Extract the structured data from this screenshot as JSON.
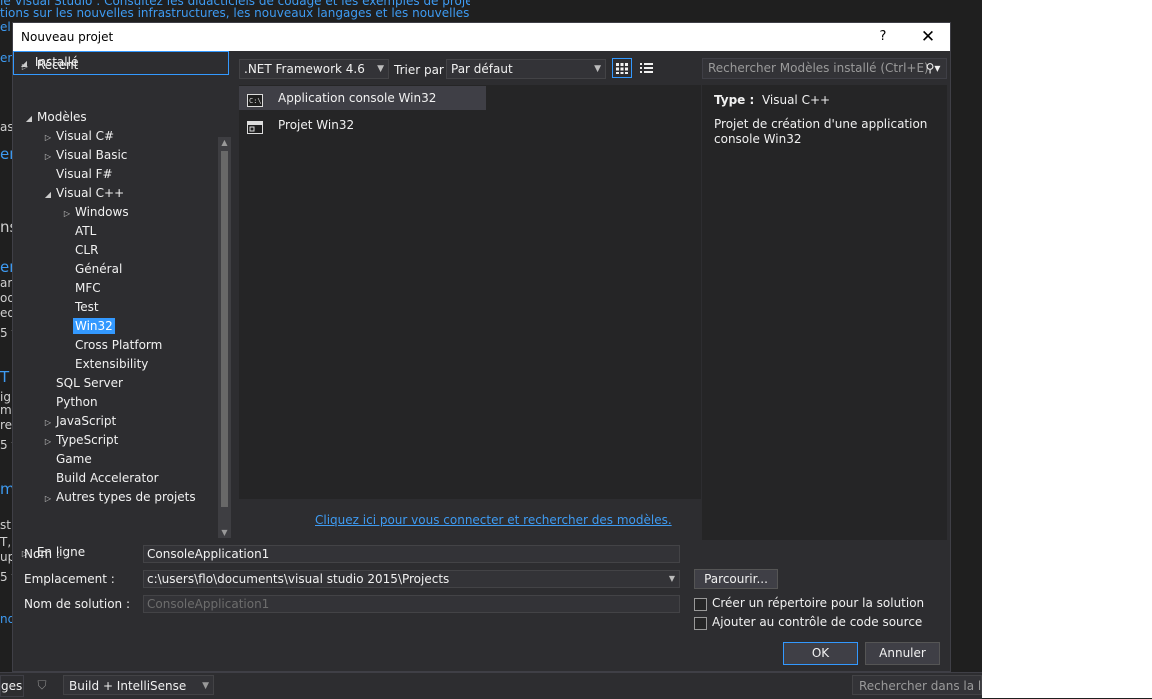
{
  "background": {
    "line1": "le Visual Studio : Consultez les didacticiels de codage et les exemples de projets",
    "line2": "tions sur les nouvelles infrastructures, les nouveaux langages et les nouvelles technologies",
    "fragments": [
      "el",
      "en",
      "ass",
      "en",
      "ns",
      "en",
      "ar",
      "od",
      "ed",
      "5 f",
      "T",
      "ig",
      "mo",
      "re",
      "5 f",
      "m",
      "st",
      "T,",
      "up",
      "5 f",
      "nd"
    ],
    "bottom_tab": "ges",
    "build_combo": "Build + IntelliSense",
    "search_list": "Rechercher dans la liste"
  },
  "dialog": {
    "title": "Nouveau projet",
    "help": "?",
    "close": "✕"
  },
  "left": {
    "recent": "Récent",
    "installed": "Installé",
    "online": "En ligne",
    "tree": [
      {
        "label": "Modèles",
        "indent": 0,
        "expander": "open"
      },
      {
        "label": "Visual C#",
        "indent": 1,
        "expander": "closed"
      },
      {
        "label": "Visual Basic",
        "indent": 1,
        "expander": "closed"
      },
      {
        "label": "Visual F#",
        "indent": 1,
        "expander": "none"
      },
      {
        "label": "Visual C++",
        "indent": 1,
        "expander": "open"
      },
      {
        "label": "Windows",
        "indent": 2,
        "expander": "closed"
      },
      {
        "label": "ATL",
        "indent": 2,
        "expander": "none"
      },
      {
        "label": "CLR",
        "indent": 2,
        "expander": "none"
      },
      {
        "label": "Général",
        "indent": 2,
        "expander": "none"
      },
      {
        "label": "MFC",
        "indent": 2,
        "expander": "none"
      },
      {
        "label": "Test",
        "indent": 2,
        "expander": "none"
      },
      {
        "label": "Win32",
        "indent": 2,
        "expander": "none",
        "selected": true
      },
      {
        "label": "Cross Platform",
        "indent": 2,
        "expander": "none"
      },
      {
        "label": "Extensibility",
        "indent": 2,
        "expander": "none"
      },
      {
        "label": "SQL Server",
        "indent": 1,
        "expander": "none"
      },
      {
        "label": "Python",
        "indent": 1,
        "expander": "none"
      },
      {
        "label": "JavaScript",
        "indent": 1,
        "expander": "closed"
      },
      {
        "label": "TypeScript",
        "indent": 1,
        "expander": "closed"
      },
      {
        "label": "Game",
        "indent": 1,
        "expander": "none"
      },
      {
        "label": "Build Accelerator",
        "indent": 1,
        "expander": "none"
      },
      {
        "label": "Autres types de projets",
        "indent": 1,
        "expander": "closed"
      }
    ]
  },
  "toolbar": {
    "framework": ".NET Framework 4.6",
    "sort_label": "Trier par :",
    "sort_value": "Par défaut",
    "search_placeholder": "Rechercher Modèles installé (Ctrl+E)"
  },
  "templates": [
    {
      "label": "Application console Win32",
      "icon": "console-app-icon",
      "selected": true
    },
    {
      "label": "Projet Win32",
      "icon": "win32-project-icon",
      "selected": false
    }
  ],
  "connect_link": "Cliquez ici pour vous connecter et rechercher des modèles.",
  "detail": {
    "type_label": "Type :",
    "type_value": "Visual C++",
    "description": "Projet de création d'une application console Win32"
  },
  "form": {
    "name_label": "Nom :",
    "name_value": "ConsoleApplication1",
    "location_label": "Emplacement :",
    "location_value": "c:\\users\\flo\\documents\\visual studio 2015\\Projects",
    "solution_label": "Nom de solution :",
    "solution_value": "ConsoleApplication1",
    "browse": "Parcourir...",
    "create_dir": "Créer un répertoire pour la solution",
    "create_dir_checked": false,
    "source_control": "Ajouter au contrôle de code source",
    "source_control_checked": false,
    "ok": "OK",
    "cancel": "Annuler"
  },
  "colors": {
    "accent": "#3399ff",
    "link": "#3e9bf2",
    "panel": "#252526",
    "chrome": "#2d2d30"
  }
}
